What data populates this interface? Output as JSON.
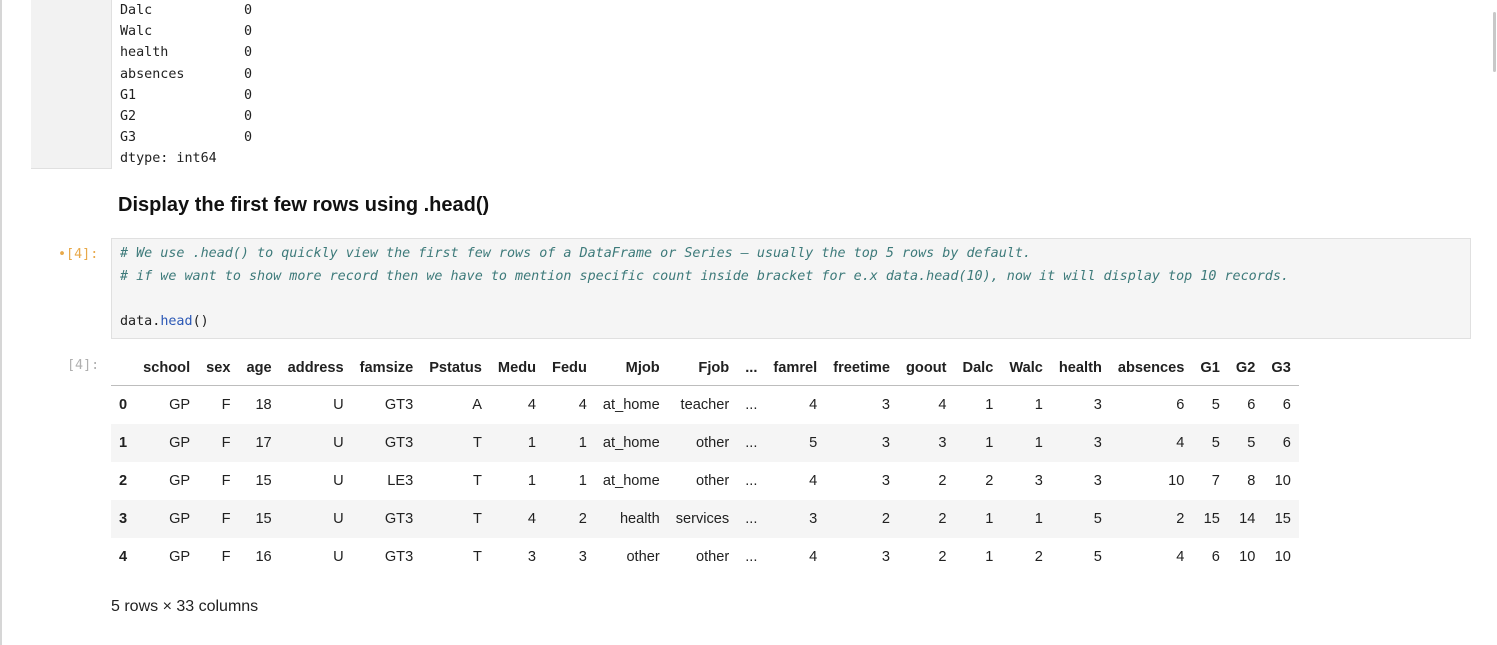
{
  "previous_output": {
    "series": [
      {
        "key": "Dalc",
        "value": "0"
      },
      {
        "key": "Walc",
        "value": "0"
      },
      {
        "key": "health",
        "value": "0"
      },
      {
        "key": "absences",
        "value": "0"
      },
      {
        "key": "G1",
        "value": "0"
      },
      {
        "key": "G2",
        "value": "0"
      },
      {
        "key": "G3",
        "value": "0"
      }
    ],
    "dtype": "dtype: int64"
  },
  "markdown": {
    "heading": "Display the first few rows using .head()"
  },
  "code_cell": {
    "prompt": "•[4]:",
    "comment_line_1": "# We use .head() to quickly view the first few rows of a DataFrame or Series — usually the top 5 rows by default.",
    "comment_line_2": "# if we want to show more record then we have to mention specific count inside bracket for e.x data.head(10), now it will display top 10 records.",
    "code_obj": "data.",
    "code_method": "head",
    "code_parens": "()"
  },
  "output_cell": {
    "prompt": "[4]:",
    "columns": [
      "school",
      "sex",
      "age",
      "address",
      "famsize",
      "Pstatus",
      "Medu",
      "Fedu",
      "Mjob",
      "Fjob",
      "...",
      "famrel",
      "freetime",
      "goout",
      "Dalc",
      "Walc",
      "health",
      "absences",
      "G1",
      "G2",
      "G3"
    ],
    "rows": [
      {
        "index": "0",
        "cells": [
          "GP",
          "F",
          "18",
          "U",
          "GT3",
          "A",
          "4",
          "4",
          "at_home",
          "teacher",
          "...",
          "4",
          "3",
          "4",
          "1",
          "1",
          "3",
          "6",
          "5",
          "6",
          "6"
        ]
      },
      {
        "index": "1",
        "cells": [
          "GP",
          "F",
          "17",
          "U",
          "GT3",
          "T",
          "1",
          "1",
          "at_home",
          "other",
          "...",
          "5",
          "3",
          "3",
          "1",
          "1",
          "3",
          "4",
          "5",
          "5",
          "6"
        ]
      },
      {
        "index": "2",
        "cells": [
          "GP",
          "F",
          "15",
          "U",
          "LE3",
          "T",
          "1",
          "1",
          "at_home",
          "other",
          "...",
          "4",
          "3",
          "2",
          "2",
          "3",
          "3",
          "10",
          "7",
          "8",
          "10"
        ]
      },
      {
        "index": "3",
        "cells": [
          "GP",
          "F",
          "15",
          "U",
          "GT3",
          "T",
          "4",
          "2",
          "health",
          "services",
          "...",
          "3",
          "2",
          "2",
          "1",
          "1",
          "5",
          "2",
          "15",
          "14",
          "15"
        ]
      },
      {
        "index": "4",
        "cells": [
          "GP",
          "F",
          "16",
          "U",
          "GT3",
          "T",
          "3",
          "3",
          "other",
          "other",
          "...",
          "4",
          "3",
          "2",
          "1",
          "2",
          "5",
          "4",
          "6",
          "10",
          "10"
        ]
      }
    ],
    "footer": "5 rows × 33 columns"
  }
}
